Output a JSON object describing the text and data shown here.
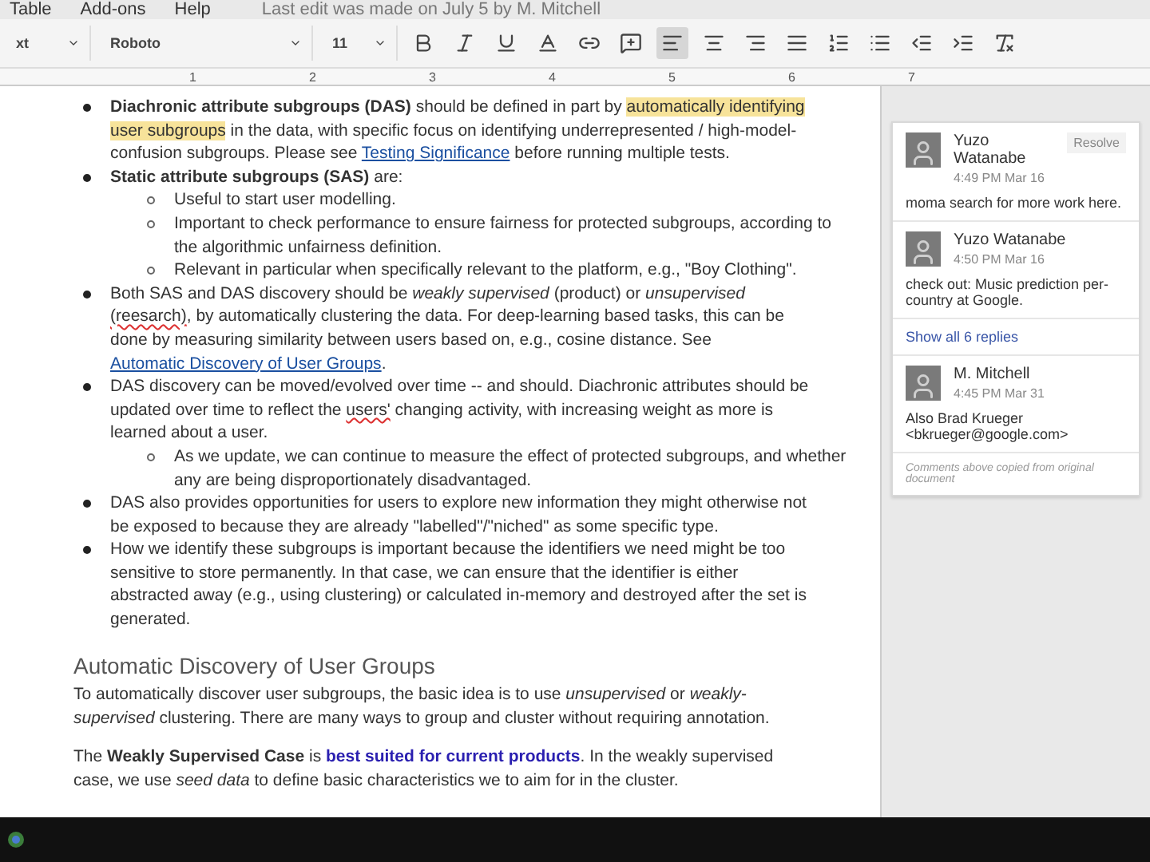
{
  "menu": {
    "items": [
      "Table",
      "Add-ons",
      "Help"
    ],
    "last_edit": "Last edit was made on July 5 by M. Mitchell"
  },
  "toolbar": {
    "style": "xt",
    "font": "Roboto",
    "size": "11",
    "alignments": [
      {
        "selected": true
      },
      {
        "selected": false
      },
      {
        "selected": false
      },
      {
        "selected": false
      }
    ]
  },
  "ruler": [
    "1",
    "2",
    "3",
    "4",
    "5",
    "6",
    "7"
  ],
  "document": {
    "items": [
      {
        "segments": [
          {
            "kind": "text",
            "text": "**Diachronic attribute subgroups (DAS)** should be defined in part by "
          },
          {
            "kind": "highlight",
            "text": "automatically identifying user subgroups"
          },
          {
            "kind": "text",
            "text": " in the data, with specific focus on identifying underrepresented / high-model-confusion subgroups.  Please see "
          },
          {
            "kind": "link",
            "text": "Testing Significance"
          },
          {
            "kind": "text",
            "text": " before running multiple tests."
          }
        ]
      },
      {
        "segments": [
          {
            "kind": "text",
            "text": "**Static attribute subgroups (SAS)** are:"
          }
        ],
        "children": [
          {
            "segments": [
              {
                "kind": "text",
                "text": "Useful to start user modelling."
              }
            ]
          },
          {
            "segments": [
              {
                "kind": "text",
                "text": "Important to check performance to ensure fairness for protected subgroups, according to the algorithmic unfairness definition."
              }
            ]
          },
          {
            "segments": [
              {
                "kind": "text",
                "text": "Relevant in particular when specifically relevant to the platform, e.g., \"Boy Clothing\"."
              }
            ]
          }
        ]
      },
      {
        "segments": [
          {
            "kind": "text",
            "text": "Both SAS and DAS discovery should be *weakly supervised* (product) or *unsupervised* "
          },
          {
            "kind": "misspelled",
            "text": "(reesarch)"
          },
          {
            "kind": "text",
            "text": ", by automatically clustering the data.  For deep-learning based tasks, this can be done by measuring similarity between users based on, e.g., cosine distance.  See "
          },
          {
            "kind": "link",
            "text": "Automatic Discovery of User Groups"
          },
          {
            "kind": "text",
            "text": "."
          }
        ]
      },
      {
        "segments": [
          {
            "kind": "text",
            "text": "DAS discovery can be moved/evolved over time -- and should.  Diachronic attributes should be updated over time to reflect the "
          },
          {
            "kind": "misspelled",
            "text": "users'"
          },
          {
            "kind": "text",
            "text": " changing activity, with increasing weight as more is learned about a user."
          }
        ],
        "children": [
          {
            "segments": [
              {
                "kind": "text",
                "text": "As we update, we can continue to measure the effect of protected subgroups, and whether any are being disproportionately disadvantaged."
              }
            ]
          }
        ]
      },
      {
        "segments": [
          {
            "kind": "text",
            "text": "DAS also provides opportunities for users to explore new information they might otherwise not be exposed to because they are already \"labelled\"/\"niched\" as some specific type."
          }
        ]
      },
      {
        "segments": [
          {
            "kind": "text",
            "text": "How we identify these subgroups is important because the identifiers we need might be too sensitive to store permanently. In that case, we can ensure that the identifier is either abstracted away (e.g., using clustering) or calculated in-memory and destroyed after the set is generated."
          }
        ]
      }
    ],
    "heading": "Automatic Discovery of User Groups",
    "paragraphs": [
      {
        "segments": [
          {
            "kind": "text",
            "text": "To automatically discover user subgroups, the basic idea is to use *unsupervised* or *weakly-supervised* clustering.  There are many ways to group and cluster without requiring annotation."
          }
        ]
      },
      {
        "segments": [
          {
            "kind": "text",
            "text": "The **Weakly Supervised Case** is "
          },
          {
            "kind": "link_bold",
            "text": "best suited for current products"
          },
          {
            "kind": "text",
            "text": ".  In the weakly supervised case, we use *seed data* to define basic characteristics we to aim for in the cluster."
          }
        ]
      }
    ]
  },
  "comments": {
    "resolve": "Resolve",
    "entries": [
      {
        "author": "Yuzo Watanabe",
        "time": "4:49 PM Mar 16",
        "text": "moma search for more work here."
      },
      {
        "author": "Yuzo Watanabe",
        "time": "4:50 PM Mar 16",
        "text": "check out: Music prediction per-country at Google."
      }
    ],
    "show_replies": "Show all 6 replies",
    "last": {
      "author": "M. Mitchell",
      "time": "4:45 PM Mar 31",
      "text": "Also Brad Krueger <bkrueger@google.com>"
    },
    "note": "Comments above copied from original document"
  }
}
